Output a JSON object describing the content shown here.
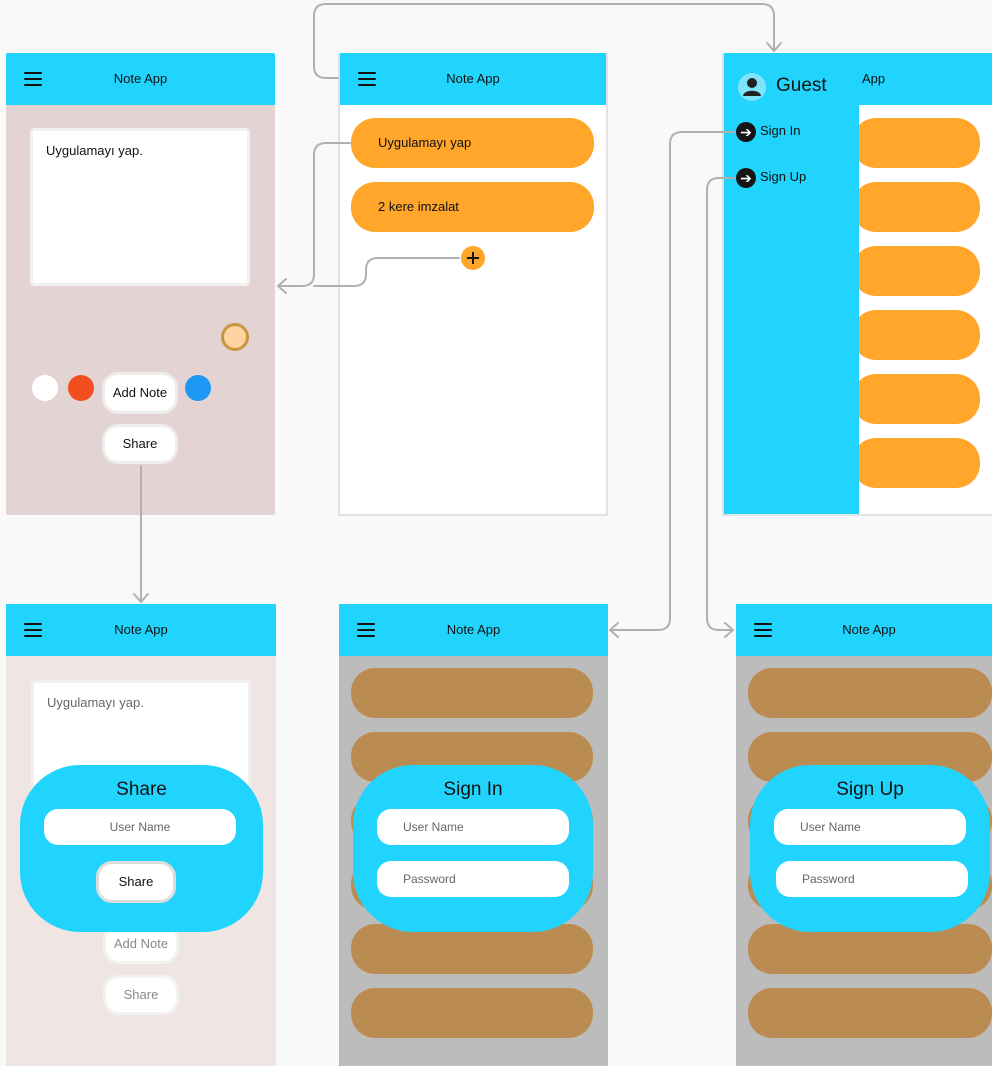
{
  "app": {
    "title": "Note App"
  },
  "screens": {
    "editor": {
      "note_text": "Uygulamayı yap.",
      "colors": [
        "#ffffff",
        "#f24e1e",
        "#ffc72c",
        "#16a34a",
        "#1e98f5",
        "#ffd3a0"
      ],
      "selected_color_border": "#c9953f",
      "add_label": "Add Note",
      "share_label": "Share",
      "background": "#e3d3d3"
    },
    "list": {
      "notes": [
        "Uygulamayı yap",
        "2 kere imzalat"
      ],
      "add_icon": "plus-icon",
      "card_color": "#ffa62b"
    },
    "drawer": {
      "title_partial": "App",
      "user": "Guest",
      "avatar_icon": "user-icon",
      "items": [
        "Sign In",
        "Sign Up"
      ],
      "item_icon": "arrow-right-circle-icon",
      "color": "#21d4fd"
    },
    "share_dialog": {
      "note_text": "Uygulamayı yap.",
      "title": "Share",
      "username_placeholder": "User Name",
      "share_label": "Share",
      "bg_add_label": "Add Note",
      "bg_share_label": "Share"
    },
    "signin_dialog": {
      "title": "Sign In",
      "username_placeholder": "User Name",
      "password_placeholder": "Password"
    },
    "signup_dialog": {
      "title": "Sign Up",
      "username_placeholder": "User Name",
      "password_placeholder": "Password"
    }
  },
  "colors": {
    "appbar": "#21d4fd",
    "accent_orange": "#ffa62b",
    "dim_overlay": "#bcbcbc",
    "dim_card": "#ba8c51",
    "connector": "#b0b0b0"
  }
}
